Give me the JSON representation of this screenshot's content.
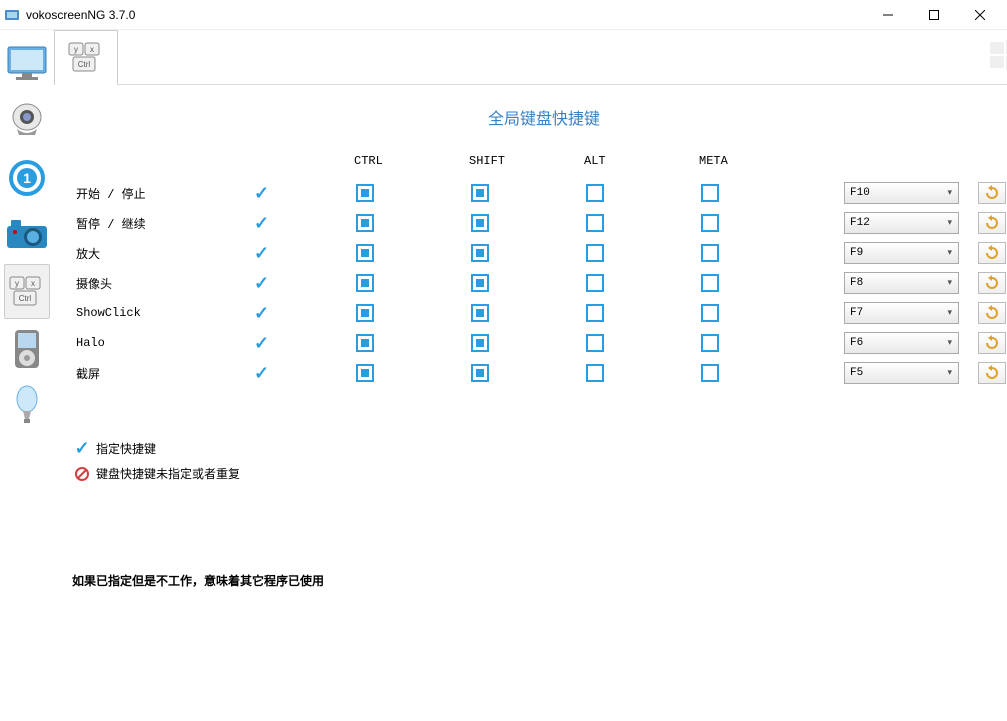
{
  "window": {
    "title": "vokoscreenNG 3.7.0"
  },
  "page": {
    "title": "全局键盘快捷键"
  },
  "headers": {
    "ctrl": "CTRL",
    "shift": "SHIFT",
    "alt": "ALT",
    "meta": "META"
  },
  "rows": [
    {
      "label": "开始 / 停止",
      "assigned": true,
      "ctrl": true,
      "shift": true,
      "alt": false,
      "meta": false,
      "key": "F10"
    },
    {
      "label": "暂停 / 继续",
      "assigned": true,
      "ctrl": true,
      "shift": true,
      "alt": false,
      "meta": false,
      "key": "F12"
    },
    {
      "label": "放大",
      "assigned": true,
      "ctrl": true,
      "shift": true,
      "alt": false,
      "meta": false,
      "key": "F9"
    },
    {
      "label": "摄像头",
      "assigned": true,
      "ctrl": true,
      "shift": true,
      "alt": false,
      "meta": false,
      "key": "F8"
    },
    {
      "label": "ShowClick",
      "assigned": true,
      "ctrl": true,
      "shift": true,
      "alt": false,
      "meta": false,
      "key": "F7"
    },
    {
      "label": "Halo",
      "assigned": true,
      "ctrl": true,
      "shift": true,
      "alt": false,
      "meta": false,
      "key": "F6"
    },
    {
      "label": "截屏",
      "assigned": true,
      "ctrl": true,
      "shift": true,
      "alt": false,
      "meta": false,
      "key": "F5"
    }
  ],
  "legend": {
    "assigned": "指定快捷键",
    "conflict": "键盘快捷键未指定或者重复"
  },
  "footnote": "如果已指定但是不工作，意味着其它程序已使用"
}
